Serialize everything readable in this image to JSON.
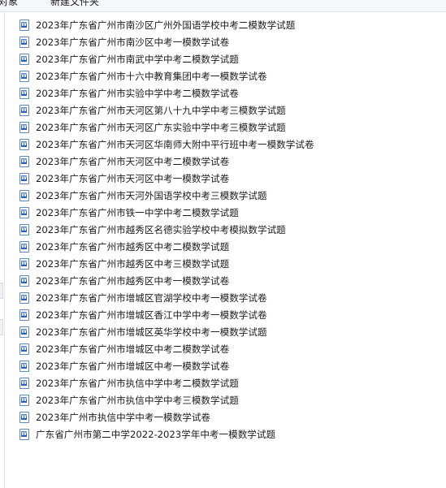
{
  "toolbar": {
    "item_left": "对象",
    "item_new_folder": "新建文件夹"
  },
  "icons": {
    "file_type": "word-document-icon",
    "badge_letter": "W"
  },
  "files": [
    {
      "name": "2023年广东省广州市南沙区广州外国语学校中考二模数学试题"
    },
    {
      "name": "2023年广东省广州市南沙区中考一模数学试卷"
    },
    {
      "name": "2023年广东省广州市南武中学中考二模数学试题"
    },
    {
      "name": "2023年广东省广州市十六中教育集团中考一模数学试卷"
    },
    {
      "name": "2023年广东省广州市实验中学中考二模数学试卷"
    },
    {
      "name": "2023年广东省广州市天河区第八十九中学中考三模数学试题"
    },
    {
      "name": "2023年广东省广州市天河区广东实验中学中考三模数学试题"
    },
    {
      "name": "2023年广东省广州市天河区华南师大附中平行班中考一模数学试卷"
    },
    {
      "name": "2023年广东省广州市天河区中考二模数学试卷"
    },
    {
      "name": "2023年广东省广州市天河区中考一模数学试卷"
    },
    {
      "name": "2023年广东省广州市天河外国语学校中考三模数学试题"
    },
    {
      "name": "2023年广东省广州市铁一中学中考二模数学试题"
    },
    {
      "name": "2023年广东省广州市越秀区名德实验学校中考模拟数学试题"
    },
    {
      "name": "2023年广东省广州市越秀区中考二模数学试题"
    },
    {
      "name": "2023年广东省广州市越秀区中考三模数学试题"
    },
    {
      "name": "2023年广东省广州市越秀区中考一模数学试卷"
    },
    {
      "name": "2023年广东省广州市增城区官湖学校中考一模数学试卷"
    },
    {
      "name": "2023年广东省广州市增城区香江中学中考一模数学试卷"
    },
    {
      "name": "2023年广东省广州市增城区英华学校中考一模数学试题"
    },
    {
      "name": "2023年广东省广州市增城区中考二模数学试卷"
    },
    {
      "name": "2023年广东省广州市增城区中考一模数学试卷"
    },
    {
      "name": "2023年广东省广州市执信中学中考二模数学试题"
    },
    {
      "name": "2023年广东省广州市执信中学中考三模数学试题"
    },
    {
      "name": "2023年广州市执信中学中考一模数学试卷"
    },
    {
      "name": "广东省广州市第二中学2022-2023学年中考一模数学试题"
    }
  ]
}
